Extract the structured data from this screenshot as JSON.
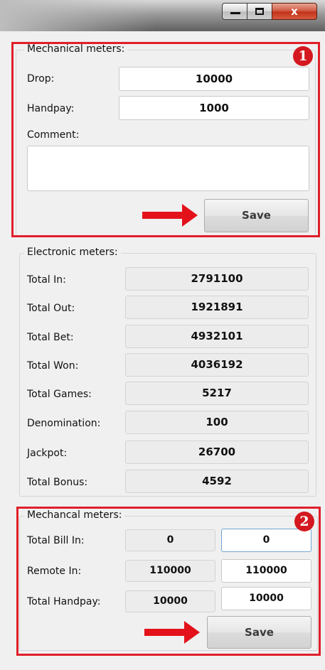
{
  "window": {
    "minimize_glyph": "",
    "maximize_glyph": "",
    "close_glyph": "x"
  },
  "mechanical": {
    "legend": "Mechanical meters:",
    "badge": "1",
    "drop_label": "Drop:",
    "drop_value": "10000",
    "handpay_label": "Handpay:",
    "handpay_value": "1000",
    "comment_label": "Comment:",
    "comment_value": "",
    "save_label": "Save"
  },
  "electronic": {
    "legend": "Electronic meters:",
    "rows": [
      {
        "label": "Total In:",
        "value": "2791100"
      },
      {
        "label": "Total Out:",
        "value": "1921891"
      },
      {
        "label": "Total Bet:",
        "value": "4932101"
      },
      {
        "label": "Total Won:",
        "value": "4036192"
      },
      {
        "label": "Total Games:",
        "value": "5217"
      },
      {
        "label": "Denomination:",
        "value": "100"
      },
      {
        "label": "Jackpot:",
        "value": "26700"
      },
      {
        "label": "Total Bonus:",
        "value": "4592"
      }
    ]
  },
  "mechancal2": {
    "legend": "Mechancal meters:",
    "badge": "2",
    "rows": [
      {
        "label": "Total Bill In:",
        "current": "0",
        "new": "0"
      },
      {
        "label": "Remote In:",
        "current": "110000",
        "new": "110000"
      },
      {
        "label": "Total Handpay:",
        "current": "10000",
        "new": "10000"
      }
    ],
    "save_label": "Save"
  },
  "colors": {
    "highlight_red": "#e01f2a",
    "badge_red": "#d4181f"
  }
}
